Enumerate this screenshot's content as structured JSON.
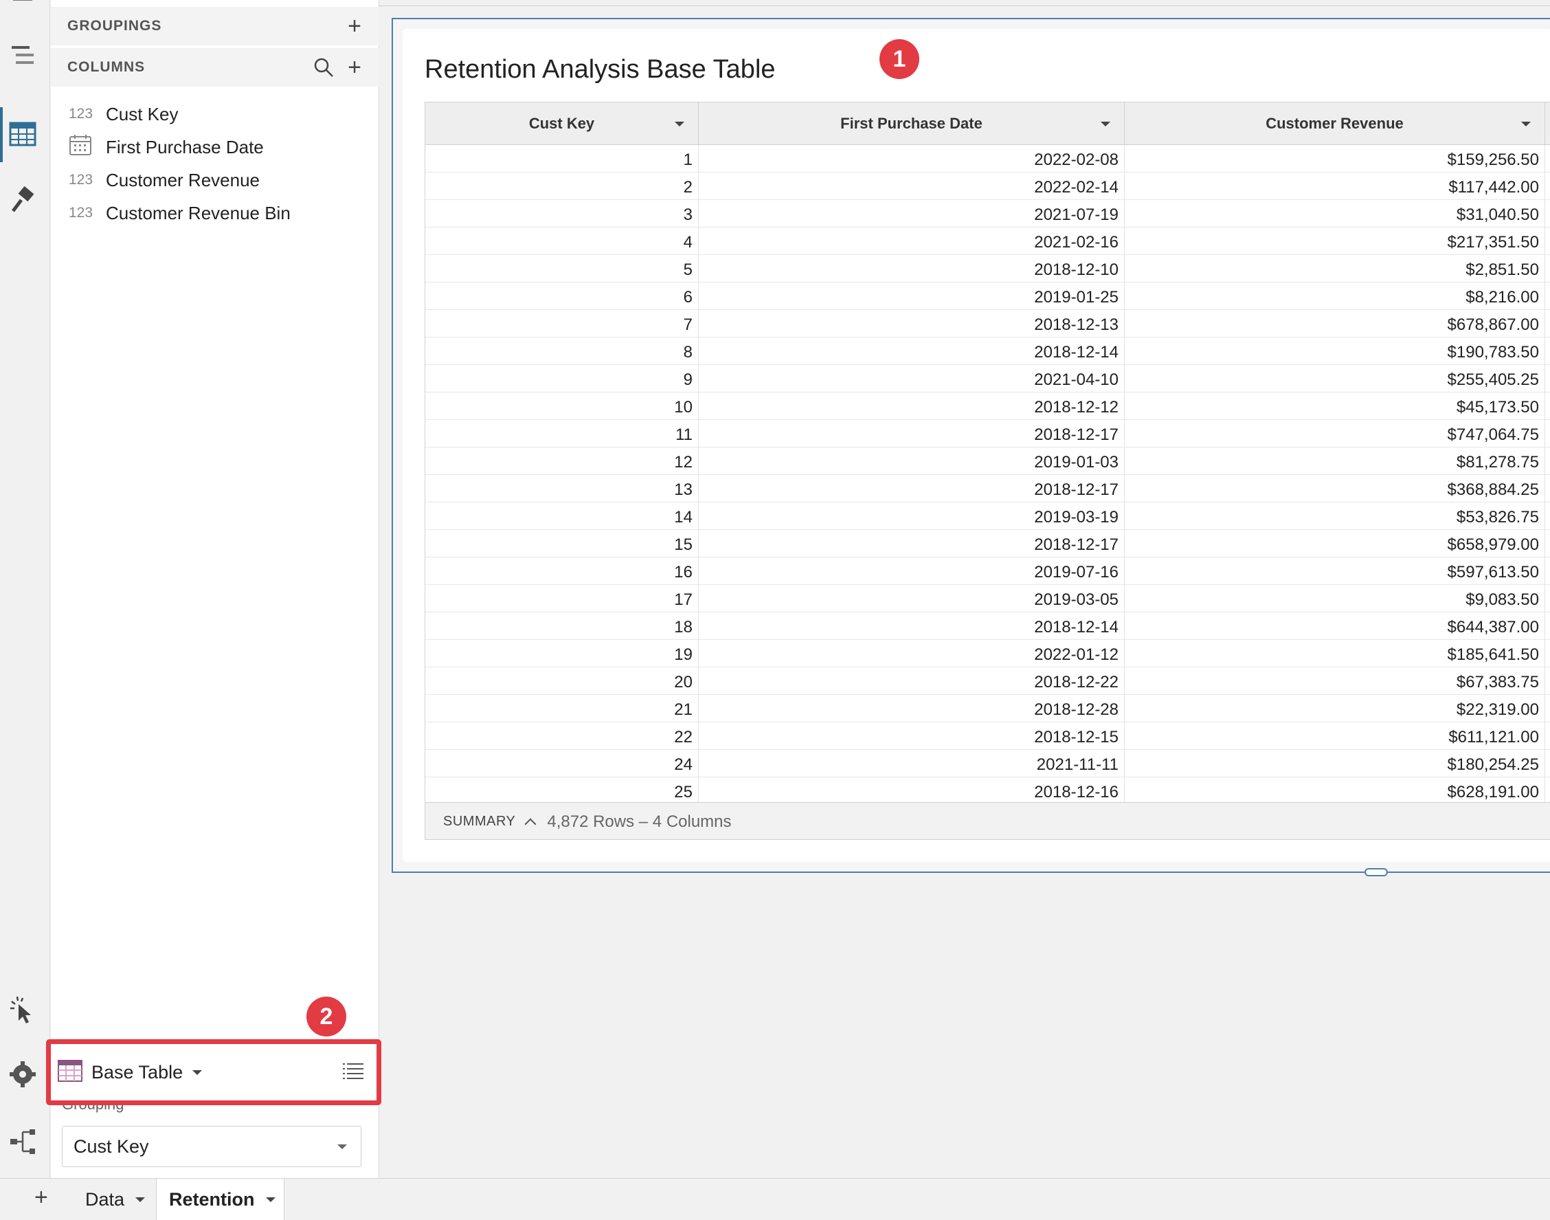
{
  "panel": {
    "groupings_label": "GROUPINGS",
    "columns_label": "COLUMNS",
    "columns": [
      {
        "type": "123",
        "name": "Cust Key"
      },
      {
        "type": "calendar",
        "name": "First Purchase Date"
      },
      {
        "type": "123",
        "name": "Customer Revenue"
      },
      {
        "type": "123",
        "name": "Customer Revenue Bin"
      }
    ],
    "element_name": "Base Table",
    "grouping_label": "Grouping",
    "grouping_value": "Cust Key"
  },
  "badges": [
    "1",
    "2"
  ],
  "table": {
    "title": "Retention Analysis Base Table",
    "headers": [
      "Cust Key",
      "First Purchase Date",
      "Customer Revenue"
    ],
    "rows": [
      [
        "1",
        "2022-02-08",
        "$159,256.50"
      ],
      [
        "2",
        "2022-02-14",
        "$117,442.00"
      ],
      [
        "3",
        "2021-07-19",
        "$31,040.50"
      ],
      [
        "4",
        "2021-02-16",
        "$217,351.50"
      ],
      [
        "5",
        "2018-12-10",
        "$2,851.50"
      ],
      [
        "6",
        "2019-01-25",
        "$8,216.00"
      ],
      [
        "7",
        "2018-12-13",
        "$678,867.00"
      ],
      [
        "8",
        "2018-12-14",
        "$190,783.50"
      ],
      [
        "9",
        "2021-04-10",
        "$255,405.25"
      ],
      [
        "10",
        "2018-12-12",
        "$45,173.50"
      ],
      [
        "11",
        "2018-12-17",
        "$747,064.75"
      ],
      [
        "12",
        "2019-01-03",
        "$81,278.75"
      ],
      [
        "13",
        "2018-12-17",
        "$368,884.25"
      ],
      [
        "14",
        "2019-03-19",
        "$53,826.75"
      ],
      [
        "15",
        "2018-12-17",
        "$658,979.00"
      ],
      [
        "16",
        "2019-07-16",
        "$597,613.50"
      ],
      [
        "17",
        "2019-03-05",
        "$9,083.50"
      ],
      [
        "18",
        "2018-12-14",
        "$644,387.00"
      ],
      [
        "19",
        "2022-01-12",
        "$185,641.50"
      ],
      [
        "20",
        "2018-12-22",
        "$67,383.75"
      ],
      [
        "21",
        "2018-12-28",
        "$22,319.00"
      ],
      [
        "22",
        "2018-12-15",
        "$611,121.00"
      ],
      [
        "24",
        "2021-11-11",
        "$180,254.25"
      ],
      [
        "25",
        "2018-12-16",
        "$628,191.00"
      ]
    ],
    "summary_label": "SUMMARY",
    "summary_count": "4,872 Rows – 4 Columns"
  },
  "tabs": [
    {
      "label": "Data",
      "active": false
    },
    {
      "label": "Retention",
      "active": true
    }
  ],
  "colors": {
    "accent": "#2f6f95",
    "highlight": "#e23b44",
    "selection": "#4a7fb0"
  }
}
